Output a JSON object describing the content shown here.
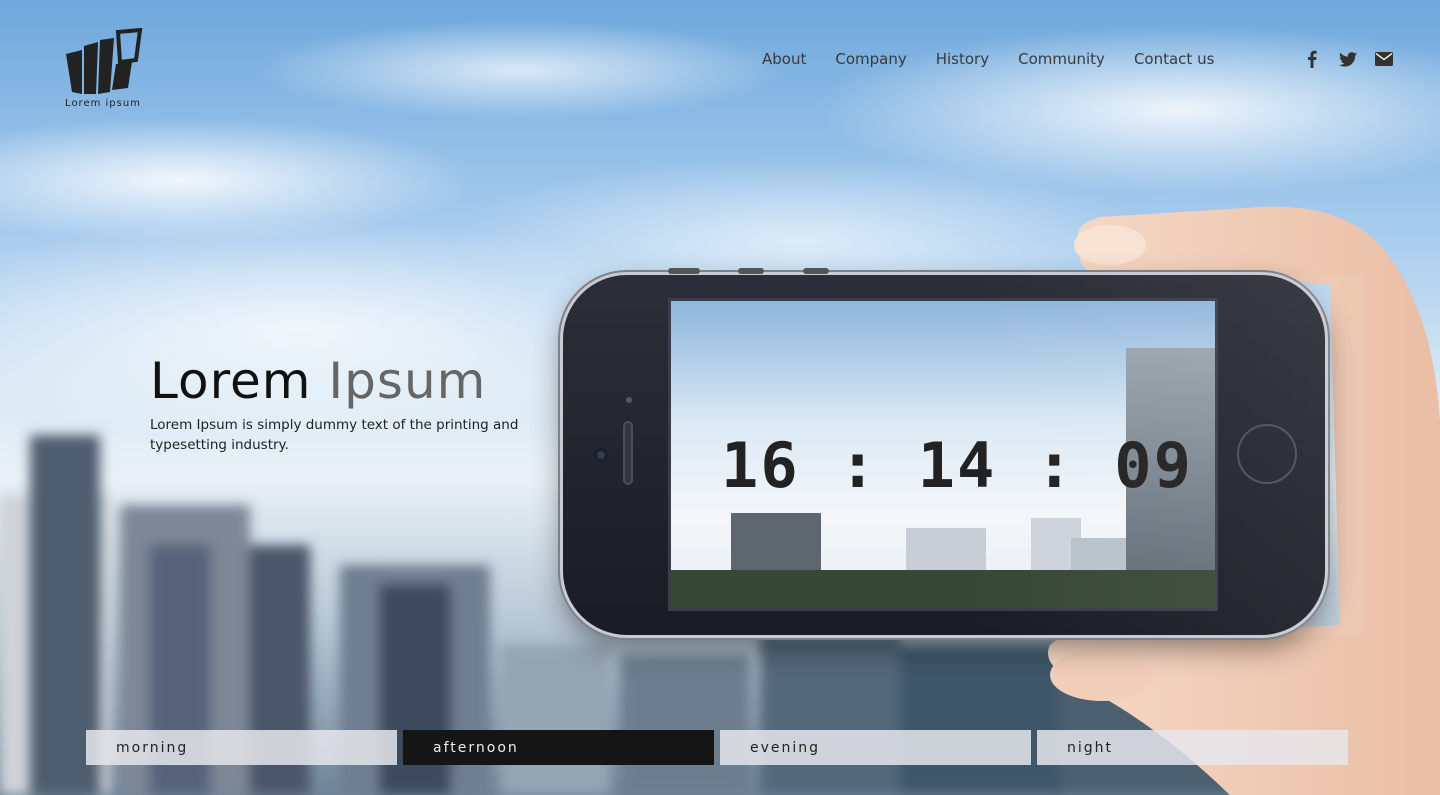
{
  "brand": {
    "logo_text": "Lorem ipsum"
  },
  "nav": {
    "items": [
      "About",
      "Company",
      "History",
      "Community",
      "Contact us"
    ]
  },
  "social": {
    "icons": [
      "facebook-icon",
      "twitter-icon",
      "envelope-icon"
    ]
  },
  "hero": {
    "title_dark": "Lorem",
    "title_light": "Ipsum",
    "subtitle": "Lorem Ipsum is simply dummy text of the printing and typesetting industry."
  },
  "clock": {
    "display": "16 : 14 : 09"
  },
  "tabs": {
    "items": [
      "morning",
      "afternoon",
      "evening",
      "night"
    ],
    "active": "afternoon"
  },
  "colors": {
    "active_tab_bg": "#151515",
    "tab_bg": "#e6e6ec",
    "text_dark": "#111111",
    "text_light": "#666666"
  }
}
